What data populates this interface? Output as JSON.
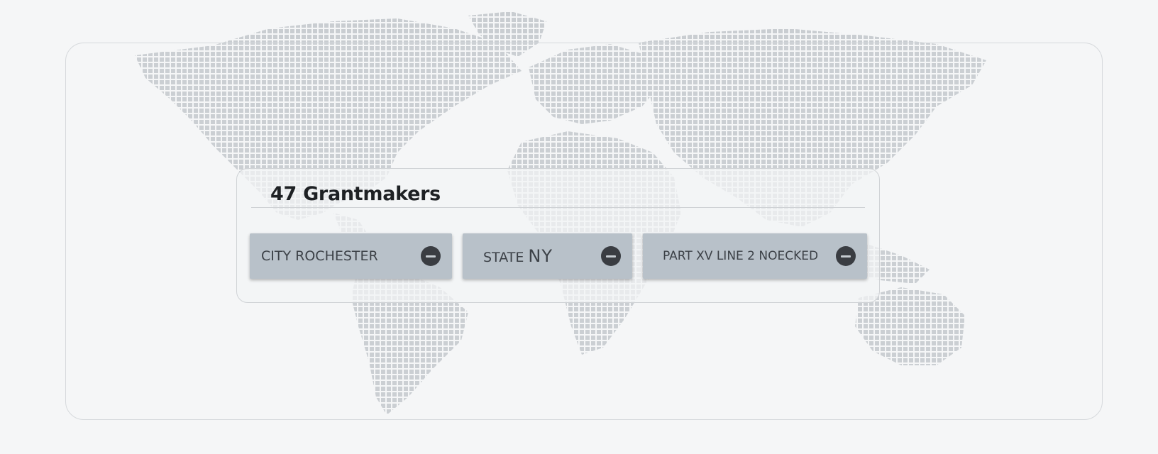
{
  "header": {
    "count_label": "47 Grantmakers"
  },
  "filters": [
    {
      "field": "CITY",
      "value": "ROCHESTER",
      "remove_icon": "minus-circle-icon"
    },
    {
      "field": "STATE",
      "value": "NY",
      "remove_icon": "minus-circle-icon"
    },
    {
      "field": "PART XV LINE 2 NOECKED",
      "value": "",
      "remove_icon": "minus-circle-icon"
    }
  ],
  "background": {
    "image": "dotted-world-map",
    "dot_color": "#c9cdd1"
  },
  "colors": {
    "chip_bg": "#b8c1c9",
    "chip_text": "#3c4147",
    "icon_bg": "#3a3d42",
    "title_text": "#1e2124"
  }
}
